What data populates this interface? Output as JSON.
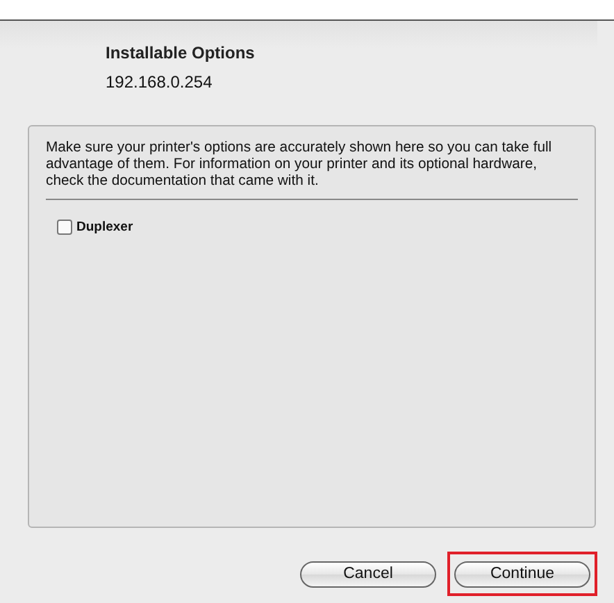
{
  "sheet": {
    "title": "Installable Options",
    "subtitle": "192.168.0.254"
  },
  "info": {
    "message": "Make sure your printer's options are accurately shown here so you can take full advantage of them.  For information on your printer and its optional hardware, check the documentation that came with it.",
    "options": [
      {
        "kind": "checkbox",
        "label": "Duplexer",
        "checked": false
      }
    ]
  },
  "buttons": [
    {
      "label": "Cancel",
      "default": false,
      "highlighted": false
    },
    {
      "label": "Continue",
      "default": false,
      "highlighted": true
    }
  ]
}
